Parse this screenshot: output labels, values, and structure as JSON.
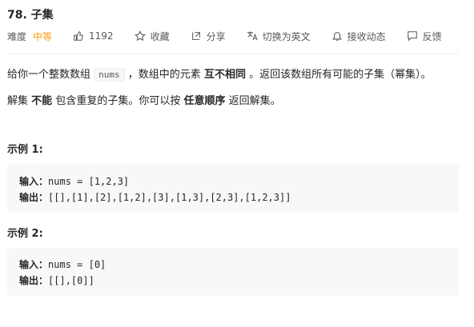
{
  "problem": {
    "title": "78. 子集"
  },
  "meta": {
    "difficulty_label": "难度",
    "difficulty_value": "中等",
    "likes": "1192",
    "favorite": "收藏",
    "share": "分享",
    "switch_lang": "切换为英文",
    "notify": "接收动态",
    "feedback": "反馈",
    "colors": {
      "difficulty": "#ffa116"
    }
  },
  "description": {
    "p1_a": "给你一个整数数组",
    "p1_code": "nums",
    "p1_b": "，数组中的元素",
    "p1_bold": "互不相同",
    "p1_c": "。返回该数组所有可能的子集（幂集）。",
    "p2_a": "解集",
    "p2_bold1": "不能",
    "p2_b": "包含重复的子集。你可以按",
    "p2_bold2": "任意顺序",
    "p2_c": "返回解集。"
  },
  "examples": [
    {
      "title": "示例 1:",
      "input_label": "输入：",
      "input": "nums = [1,2,3]",
      "output_label": "输出：",
      "output": "[[],[1],[2],[1,2],[3],[1,3],[2,3],[1,2,3]]"
    },
    {
      "title": "示例 2:",
      "input_label": "输入：",
      "input": "nums = [0]",
      "output_label": "输出：",
      "output": "[[],[0]]"
    }
  ]
}
